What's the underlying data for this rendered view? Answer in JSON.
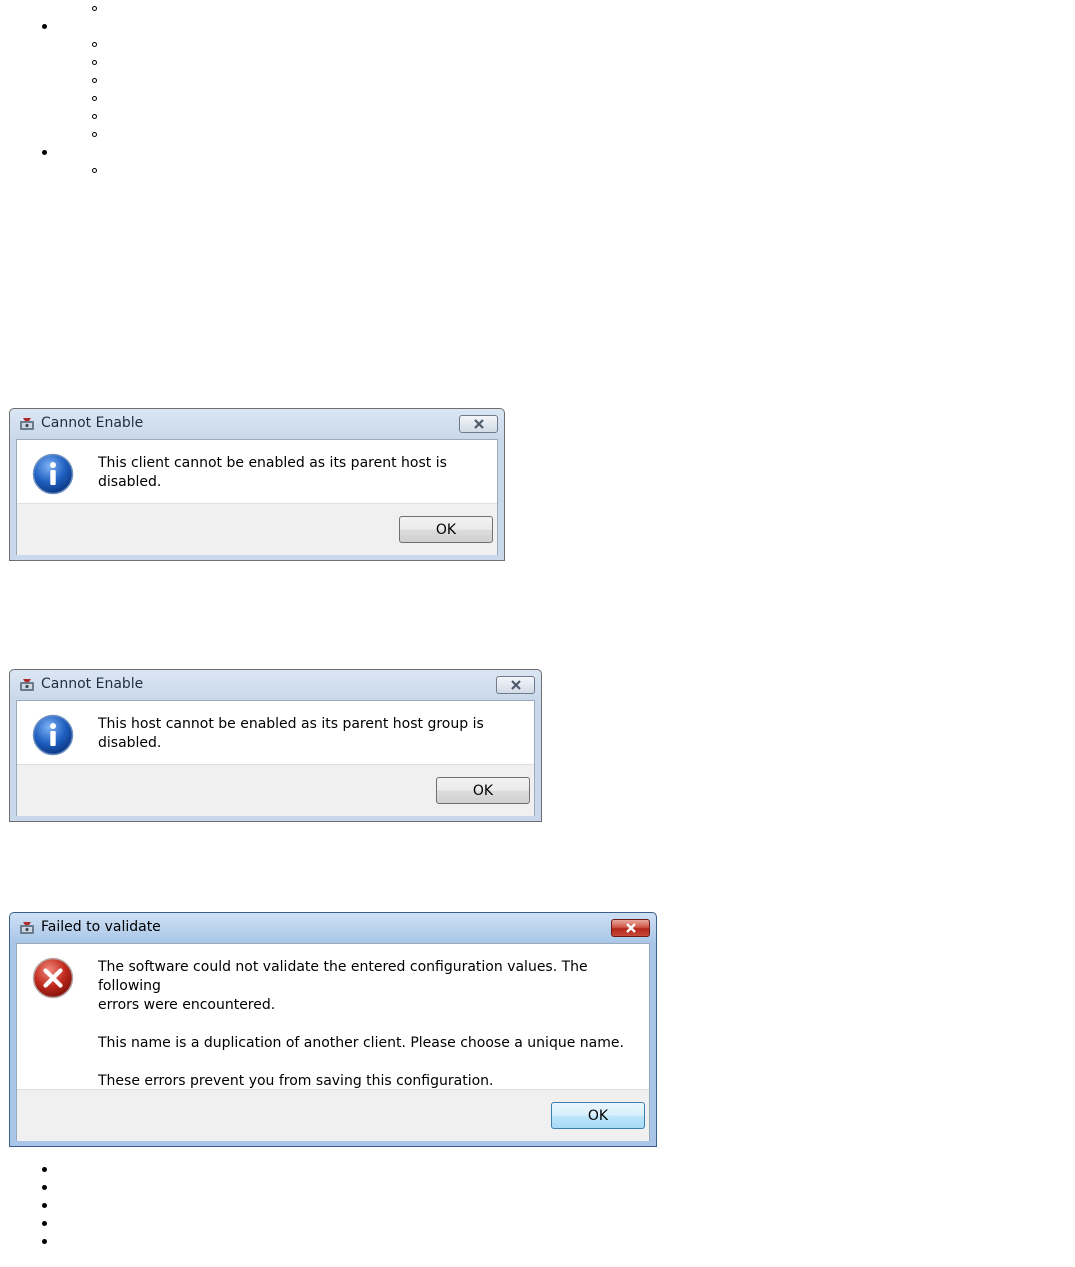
{
  "dialogs": [
    {
      "title": "Cannot Enable",
      "icon": "info-icon",
      "message": "This client cannot be enabled as its parent host is disabled.",
      "ok_label": "OK"
    },
    {
      "title": "Cannot Enable",
      "icon": "info-icon",
      "message": "This host cannot be enabled as its parent host group is disabled.",
      "ok_label": "OK"
    },
    {
      "title": "Failed to validate",
      "icon": "error-icon",
      "message_line1": "The software could not validate the entered configuration values.  The following",
      "message_line2": "errors were encountered.",
      "message_line3": "This name is a duplication of another client. Please choose a unique name.",
      "message_line4": "These errors prevent you from saving this configuration.",
      "ok_label": "OK"
    }
  ],
  "colors": {
    "info_blue": "#1f5fc0",
    "error_red": "#c0281c",
    "footer_bg": "#f0f0f0"
  }
}
